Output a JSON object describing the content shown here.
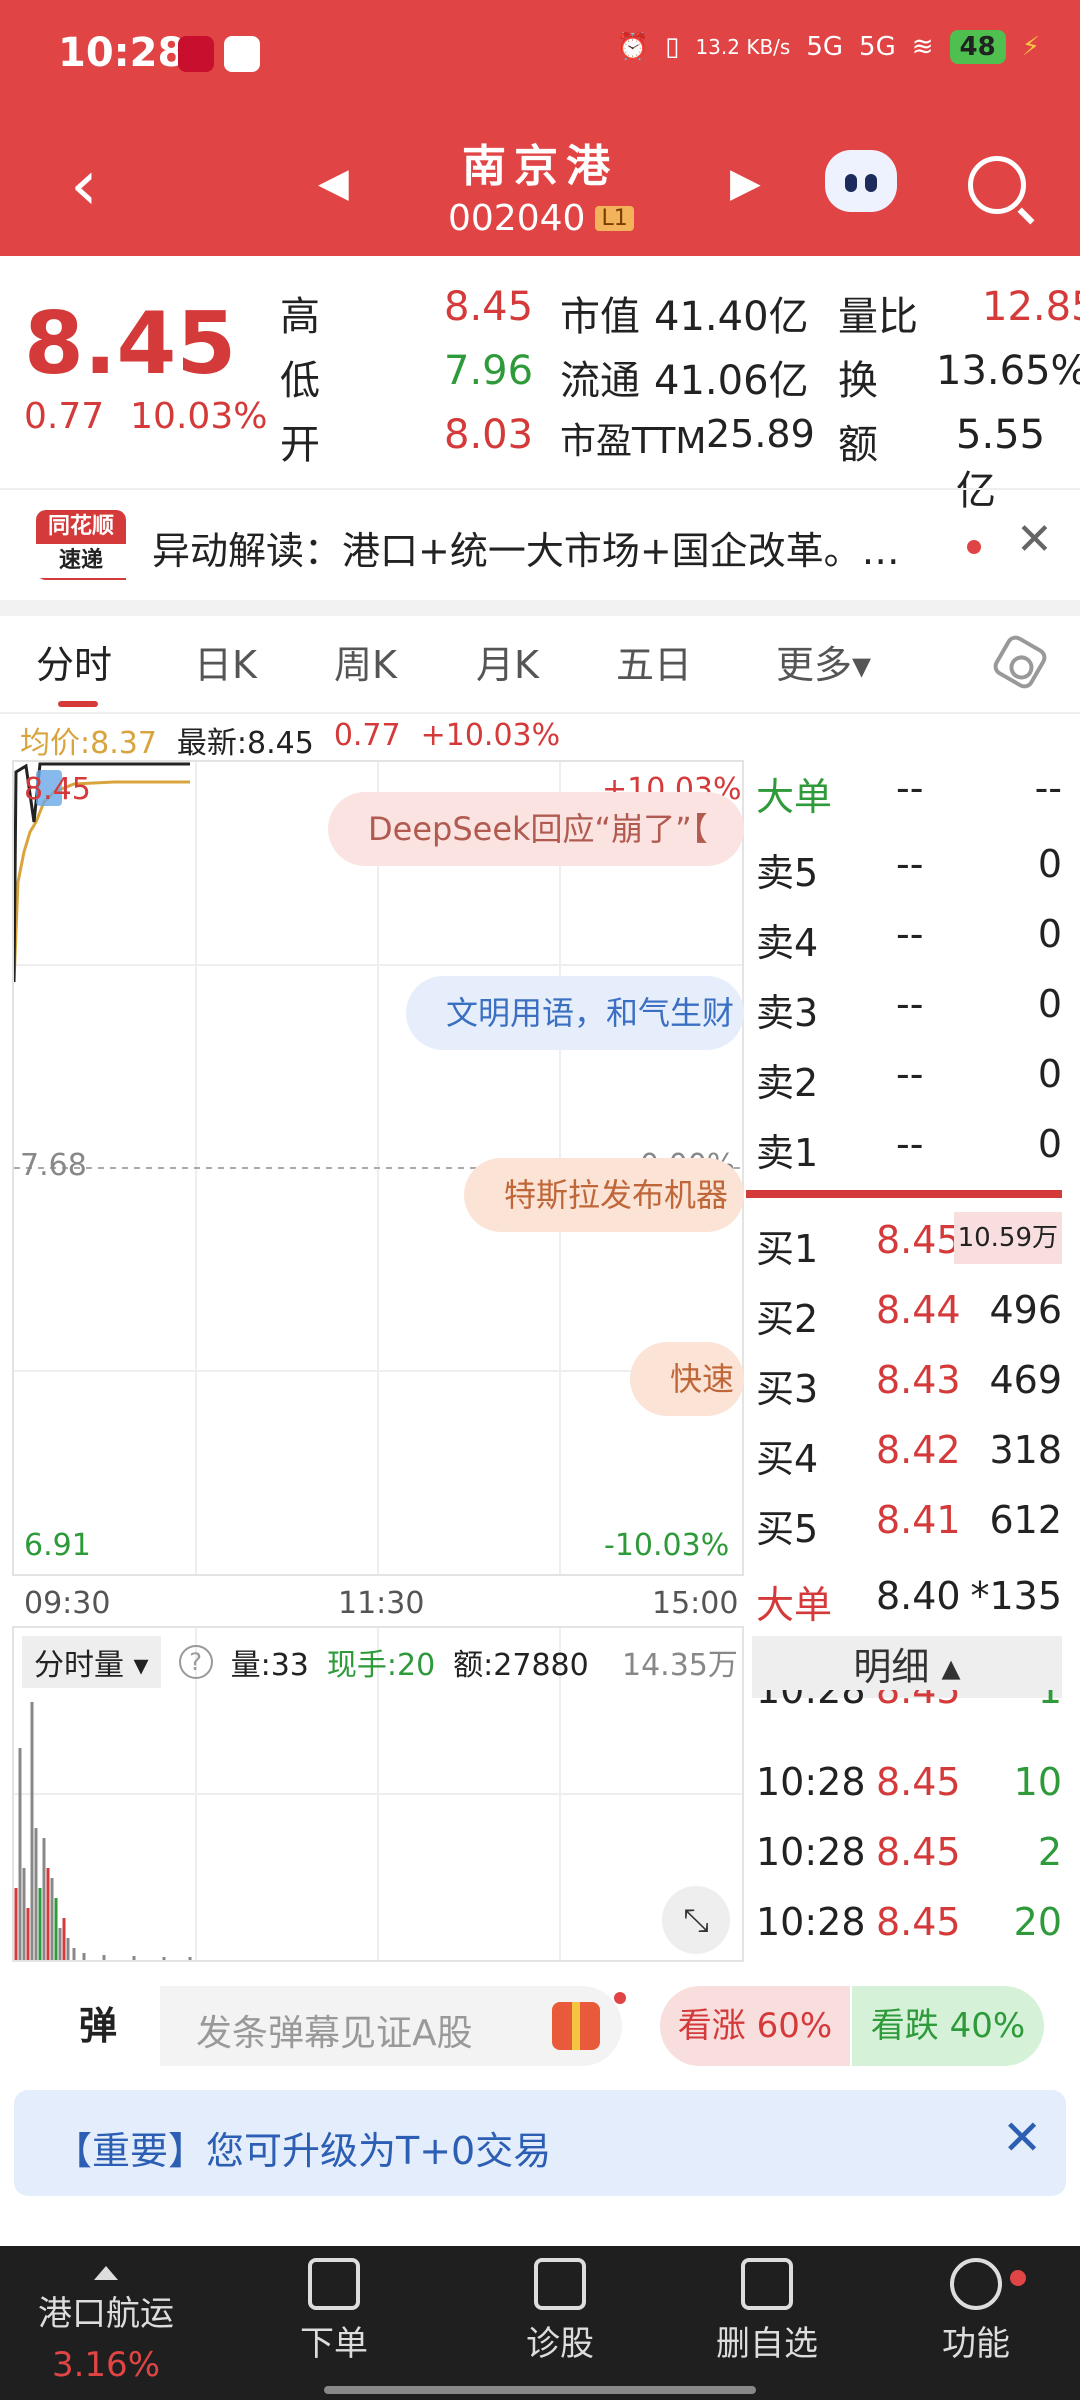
{
  "status_bar": {
    "time": "10:28",
    "net_speed": "13.2 KB/s",
    "signal1": "5G",
    "signal2": "5G",
    "battery": "48"
  },
  "nav": {
    "title": "南京港",
    "code": "002040",
    "level_badge": "L1"
  },
  "quote": {
    "price": "8.45",
    "change": "0.77",
    "change_pct": "10.03%",
    "high_label": "高",
    "high": "8.45",
    "low_label": "低",
    "low": "7.96",
    "open_label": "开",
    "open": "8.03",
    "mktcap_label": "市值",
    "mktcap": "41.40亿",
    "float_label": "流通",
    "float": "41.06亿",
    "pe_label": "市盈TTM",
    "pe": "25.89",
    "volratio_label": "量比",
    "volratio": "12.85",
    "turnover_label": "换",
    "turnover": "13.65%",
    "amount_label": "额",
    "amount": "5.55亿"
  },
  "banner": {
    "logo_line1": "同花顺",
    "logo_line2": "速递",
    "text": "异动解读：港口+统一大市场+国企改革。…"
  },
  "tabs": [
    "分时",
    "日K",
    "周K",
    "月K",
    "五日",
    "更多▾"
  ],
  "chart_info": {
    "avg_label": "均价:8.37",
    "latest_label": "最新:8.45",
    "change": "0.77",
    "change_pct": "+10.03%"
  },
  "chart": {
    "top_left": "8.45",
    "top_right": "+10.03%",
    "mid_left": "7.68",
    "mid_right": "0.00%",
    "bottom_left": "6.91",
    "bottom_right": "-10.03%",
    "times": [
      "09:30",
      "11:30",
      "15:00"
    ],
    "bubbles": [
      "DeepSeek回应“崩了”【",
      "文明用语，和气生财",
      "特斯拉发布机器",
      "快速"
    ]
  },
  "order_book": {
    "big_label": "大单",
    "big_v1": "--",
    "big_v2": "--",
    "asks": [
      {
        "label": "卖5",
        "price": "--",
        "vol": "0"
      },
      {
        "label": "卖4",
        "price": "--",
        "vol": "0"
      },
      {
        "label": "卖3",
        "price": "--",
        "vol": "0"
      },
      {
        "label": "卖2",
        "price": "--",
        "vol": "0"
      },
      {
        "label": "卖1",
        "price": "--",
        "vol": "0"
      }
    ],
    "bids": [
      {
        "label": "买1",
        "price": "8.45",
        "vol": "10.59万"
      },
      {
        "label": "买2",
        "price": "8.44",
        "vol": "496"
      },
      {
        "label": "买3",
        "price": "8.43",
        "vol": "469"
      },
      {
        "label": "买4",
        "price": "8.42",
        "vol": "318"
      },
      {
        "label": "买5",
        "price": "8.41",
        "vol": "612"
      }
    ],
    "big2_label": "大单",
    "big2_price": "8.40",
    "big2_vol": "*135",
    "detail_label": "明细 ▴",
    "ticks": [
      {
        "time": "10:28",
        "price": "8.45",
        "vol": "1"
      },
      {
        "time": "10:28",
        "price": "8.45",
        "vol": "10"
      },
      {
        "time": "10:28",
        "price": "8.45",
        "vol": "2"
      },
      {
        "time": "10:28",
        "price": "8.45",
        "vol": "20"
      }
    ]
  },
  "volume": {
    "selector": "分时量 ▾",
    "qty": "量:33",
    "hand": "现手:20",
    "amt": "额:27880",
    "max": "14.35万"
  },
  "danmu": {
    "button": "弹",
    "placeholder": "发条弹幕见证A股",
    "up": "看涨 60%",
    "down": "看跌 40%"
  },
  "notice": {
    "text": "【重要】您可升级为T+0交易"
  },
  "bottom": {
    "sector": "港口航运",
    "sector_pct": "3.16%",
    "items": [
      "下单",
      "诊股",
      "删自选",
      "功能"
    ]
  },
  "colors": {
    "brand_red": "#e14444",
    "up_red": "#d43a3a",
    "down_green": "#2e9a3a",
    "avg_gold": "#d9a43d"
  }
}
